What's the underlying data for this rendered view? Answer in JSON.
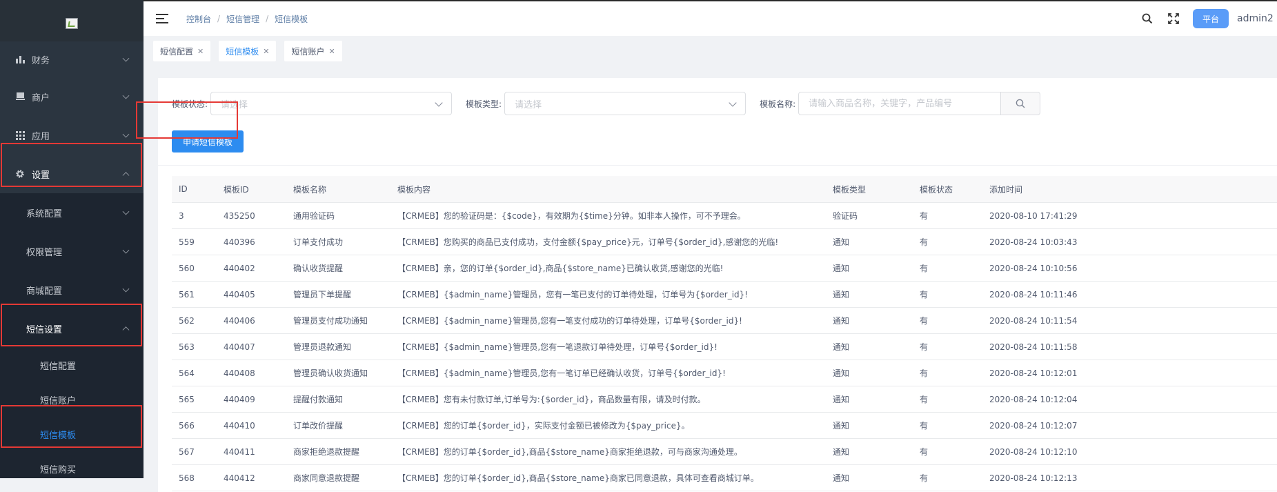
{
  "sidebar": {
    "menu": [
      {
        "label": "财务",
        "icon": "bar-chart-icon"
      },
      {
        "label": "商户",
        "icon": "merchant-icon"
      },
      {
        "label": "应用",
        "icon": "grid-icon"
      },
      {
        "label": "设置",
        "icon": "gear-icon"
      }
    ],
    "settings_sub": [
      {
        "label": "系统配置"
      },
      {
        "label": "权限管理"
      },
      {
        "label": "商城配置"
      },
      {
        "label": "短信设置"
      }
    ],
    "sms_leaves": [
      {
        "label": "短信配置"
      },
      {
        "label": "短信账户"
      },
      {
        "label": "短信模板"
      },
      {
        "label": "短信购买"
      }
    ]
  },
  "header": {
    "breadcrumb": [
      "控制台",
      "短信管理",
      "短信模板"
    ],
    "platform_label": "平台",
    "user": "admin2"
  },
  "tabs": [
    {
      "label": "短信配置",
      "active": false
    },
    {
      "label": "短信模板",
      "active": true
    },
    {
      "label": "短信账户",
      "active": false
    }
  ],
  "filters": {
    "status_label": "模板状态:",
    "status_placeholder": "请选择",
    "type_label": "模板类型:",
    "type_placeholder": "请选择",
    "name_label": "模板名称:",
    "name_placeholder": "请输入商品名称，关键字，产品编号"
  },
  "apply_button": "申请短信模板",
  "table": {
    "columns": [
      "ID",
      "模板ID",
      "模板名称",
      "模板内容",
      "模板类型",
      "模板状态",
      "添加时间"
    ],
    "rows": [
      [
        "3",
        "435250",
        "通用验证码",
        "【CRMEB】您的验证码是：{$code}，有效期为{$time}分钟。如非本人操作，可不予理会。",
        "验证码",
        "有",
        "2020-08-10 17:41:29"
      ],
      [
        "559",
        "440396",
        "订单支付成功",
        "【CRMEB】您购买的商品已支付成功，支付金额{$pay_price}元，订单号{$order_id},感谢您的光临!",
        "通知",
        "有",
        "2020-08-24 10:03:43"
      ],
      [
        "560",
        "440402",
        "确认收货提醒",
        "【CRMEB】亲，您的订单{$order_id},商品{$store_name}已确认收货,感谢您的光临!",
        "通知",
        "有",
        "2020-08-24 10:10:56"
      ],
      [
        "561",
        "440405",
        "管理员下单提醒",
        "【CRMEB】{$admin_name}管理员，您有一笔已支付的订单待处理，订单号为{$order_id}!",
        "通知",
        "有",
        "2020-08-24 10:11:46"
      ],
      [
        "562",
        "440406",
        "管理员支付成功通知",
        "【CRMEB】{$admin_name}管理员,您有一笔支付成功的订单待处理，订单号{$order_id}!",
        "通知",
        "有",
        "2020-08-24 10:11:54"
      ],
      [
        "563",
        "440407",
        "管理员退款通知",
        "【CRMEB】{$admin_name}管理员,您有一笔退款订单待处理，订单号{$order_id}!",
        "通知",
        "有",
        "2020-08-24 10:11:58"
      ],
      [
        "564",
        "440408",
        "管理员确认收货通知",
        "【CRMEB】{$admin_name}管理员,您有一笔订单已经确认收货，订单号{$order_id}!",
        "通知",
        "有",
        "2020-08-24 10:12:01"
      ],
      [
        "565",
        "440409",
        "提醒付款通知",
        "【CRMEB】您有未付款订单,订单号为:{$order_id}，商品数量有限，请及时付款。",
        "通知",
        "有",
        "2020-08-24 10:12:04"
      ],
      [
        "566",
        "440410",
        "订单改价提醒",
        "【CRMEB】您的订单{$order_id}，实际支付金额已被修改为{$pay_price}。",
        "通知",
        "有",
        "2020-08-24 10:12:07"
      ],
      [
        "567",
        "440411",
        "商家拒绝退款提醒",
        "【CRMEB】您的订单{$order_id},商品{$store_name}商家拒绝退款，可与商家沟通处理。",
        "通知",
        "有",
        "2020-08-24 10:12:10"
      ],
      [
        "568",
        "440412",
        "商家同意退款提醒",
        "【CRMEB】您的订单{$order_id},商品{$store_name}商家已同意退款，具体可查看商城订单。",
        "通知",
        "有",
        "2020-08-24 10:12:13"
      ]
    ]
  }
}
